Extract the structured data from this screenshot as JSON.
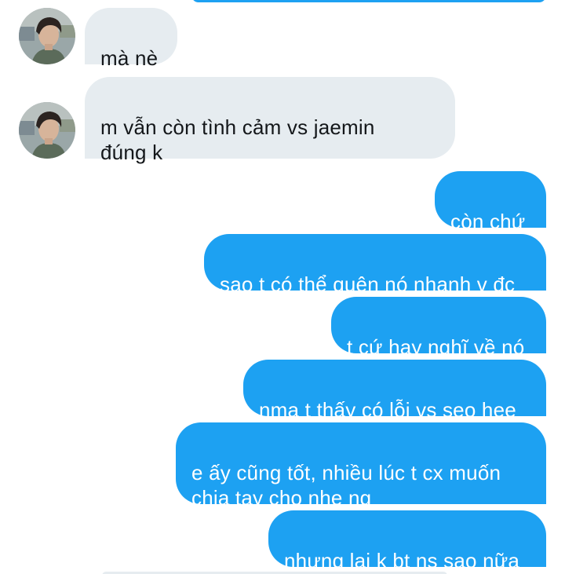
{
  "conversation": {
    "received": [
      {
        "text": "mà nè"
      },
      {
        "text": "m vẫn còn tình cảm vs jaemin\nđúng k"
      }
    ],
    "sent": [
      {
        "text": "còn chứ"
      },
      {
        "text": "sao t có thể quên nó nhanh v đc"
      },
      {
        "text": "t cứ hay nghĩ về nó"
      },
      {
        "text": "nma t thấy có lỗi vs seo hee"
      },
      {
        "text": "e ấy cũng tốt, nhiều lúc t cx muốn\nchia tay cho nhẹ ng"
      },
      {
        "text": "nhưng lại k bt ns sao nữa"
      }
    ]
  },
  "colors": {
    "sent_bubble": "#1da1f2",
    "received_bubble": "#e6ecf0",
    "sent_text": "#ffffff",
    "received_text": "#14171a"
  }
}
